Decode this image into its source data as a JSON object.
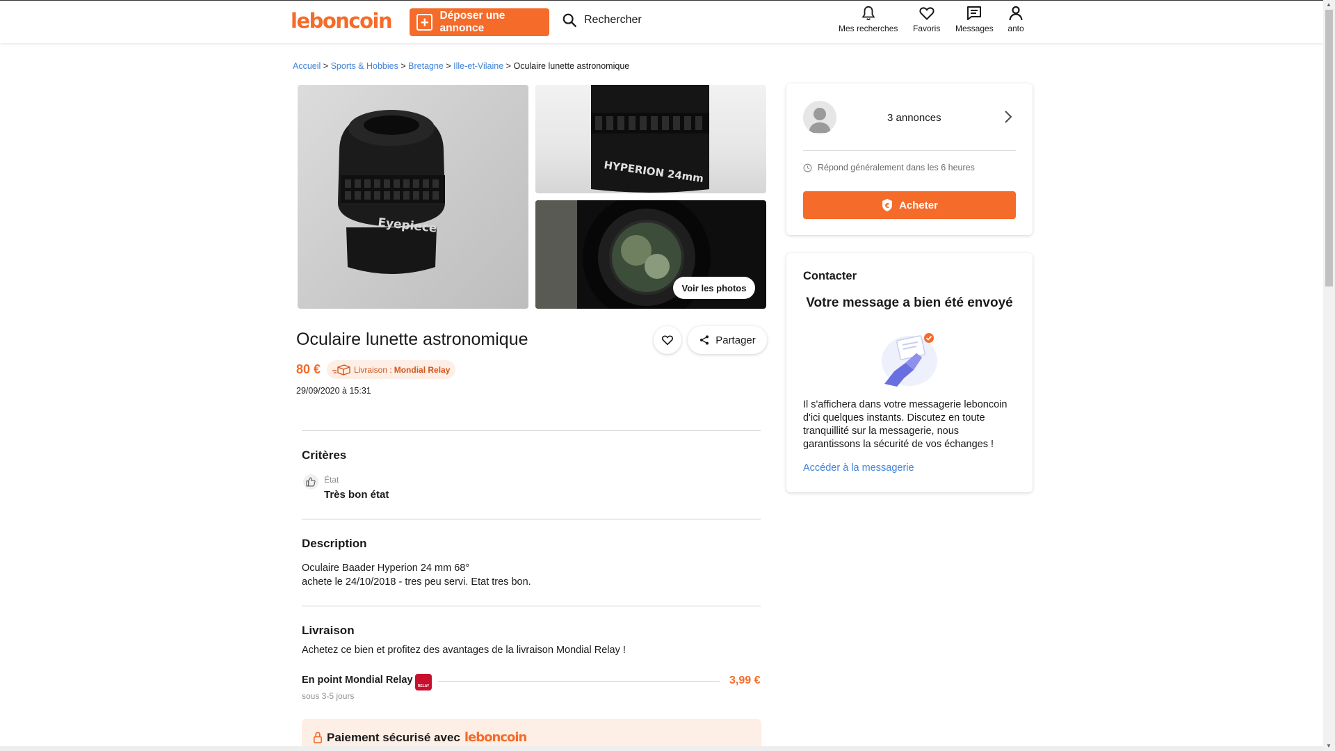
{
  "header": {
    "logo": "leboncoin",
    "deposit_label": "Déposer une annonce",
    "search_label": "Rechercher",
    "nav": [
      {
        "label": "Mes recherches",
        "icon": "bell-icon"
      },
      {
        "label": "Favoris",
        "icon": "heart-icon"
      },
      {
        "label": "Messages",
        "icon": "messages-icon"
      },
      {
        "label": "anto",
        "icon": "user-icon"
      }
    ]
  },
  "breadcrumb": {
    "items": [
      "Accueil",
      "Sports & Hobbies",
      "Bretagne",
      "Ille-et-Vilaine"
    ],
    "current": "Oculaire lunette astronomique",
    "separator": ">"
  },
  "gallery": {
    "main_photo_text": "Eyepiece",
    "photo_text_2": "HYPERION 24mm",
    "see_photos_label": "Voir les photos"
  },
  "listing": {
    "title": "Oculaire lunette astronomique",
    "share_label": "Partager",
    "price": "80 €",
    "delivery_prefix": "Livraison :",
    "delivery_carrier": "Mondial Relay",
    "date": "29/09/2020 à 15:31"
  },
  "criteria": {
    "title": "Critères",
    "label": "État",
    "value": "Très bon état"
  },
  "description": {
    "title": "Description",
    "lines": [
      "Oculaire Baader Hyperion 24 mm 68°",
      "achete le 24/10/2018 - tres peu servi. Etat tres bon."
    ]
  },
  "delivery": {
    "title": "Livraison",
    "text": "Achetez ce bien et profitez des avantages de la livraison Mondial Relay !",
    "option_name": "En point Mondial Relay",
    "option_price": "3,99 €",
    "option_delay": "sous 3-5 jours",
    "relay_logo_text": "RELAY"
  },
  "secure": {
    "prefix": "Paiement sécurisé avec",
    "brand": "leboncoin"
  },
  "seller": {
    "ads_count": "3 annonces",
    "response_time": "Répond généralement dans les 6 heures",
    "buy_label": "Acheter"
  },
  "contact": {
    "title": "Contacter",
    "sent_title": "Votre message a bien été envoyé",
    "body": "Il s'affichera dans votre messagerie leboncoin d'ici quelques instants. Discutez en toute tranquillité sur la messagerie, nous garantissons la sécurité de vos échanges !",
    "link": "Accéder à la messagerie"
  },
  "colors": {
    "brand_orange": "#f56b2a",
    "link_blue": "#4183d7",
    "badge_bg": "#fdeee6"
  }
}
